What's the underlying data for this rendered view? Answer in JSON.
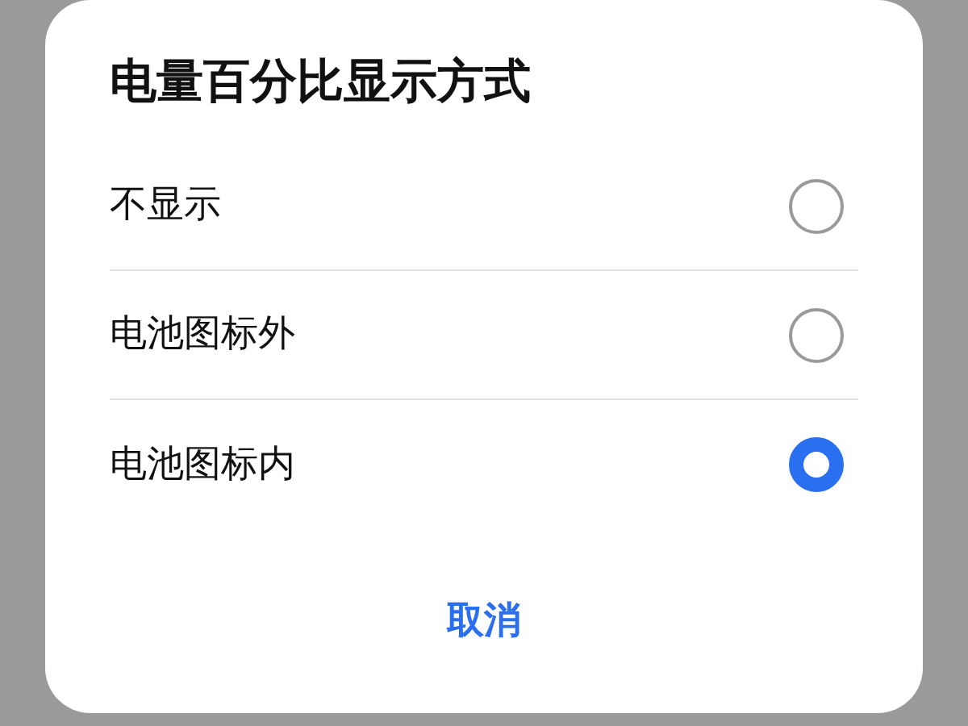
{
  "dialog": {
    "title": "电量百分比显示方式",
    "options": [
      {
        "label": "不显示",
        "selected": false
      },
      {
        "label": "电池图标外",
        "selected": false
      },
      {
        "label": "电池图标内",
        "selected": true
      }
    ],
    "buttons": [
      "取消"
    ]
  }
}
